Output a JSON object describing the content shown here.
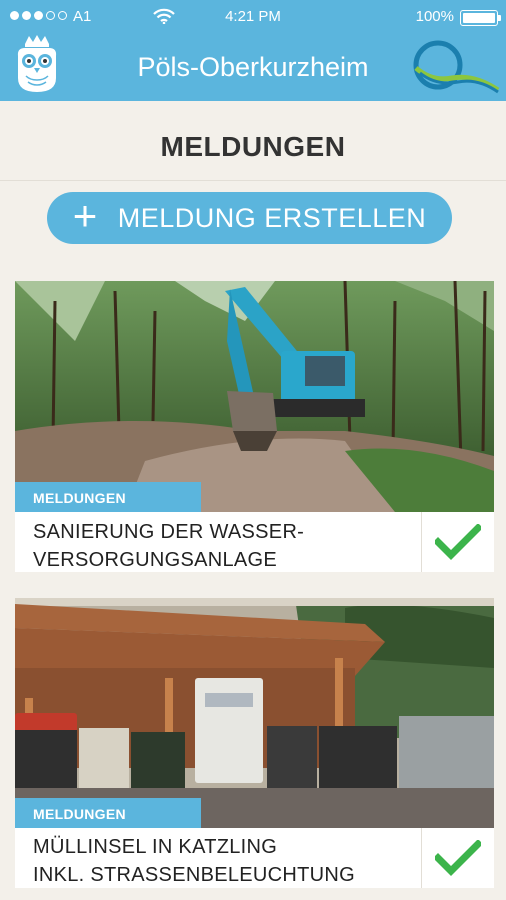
{
  "status_bar": {
    "carrier": "A1",
    "time": "4:21 PM",
    "battery": "100%"
  },
  "app_bar": {
    "title": "Pöls-Oberkurzheim"
  },
  "page": {
    "section_title": "MELDUNGEN",
    "create_button_label": "MELDUNG ERSTELLEN"
  },
  "cards": [
    {
      "category": "MELDUNGEN",
      "title_line1": "SANIERUNG DER WASSER-",
      "title_line2": "VERSORGUNGSANLAGE",
      "status_icon": "check-icon"
    },
    {
      "category": "MELDUNGEN",
      "title_line1": "MÜLLINSEL IN KATZLING",
      "title_line2": "INKL. STRASSENBELEUCHTUNG",
      "status_icon": "check-icon"
    }
  ],
  "colors": {
    "accent": "#5bb5dd",
    "check": "#3cb44b",
    "background": "#f3f0ea"
  }
}
